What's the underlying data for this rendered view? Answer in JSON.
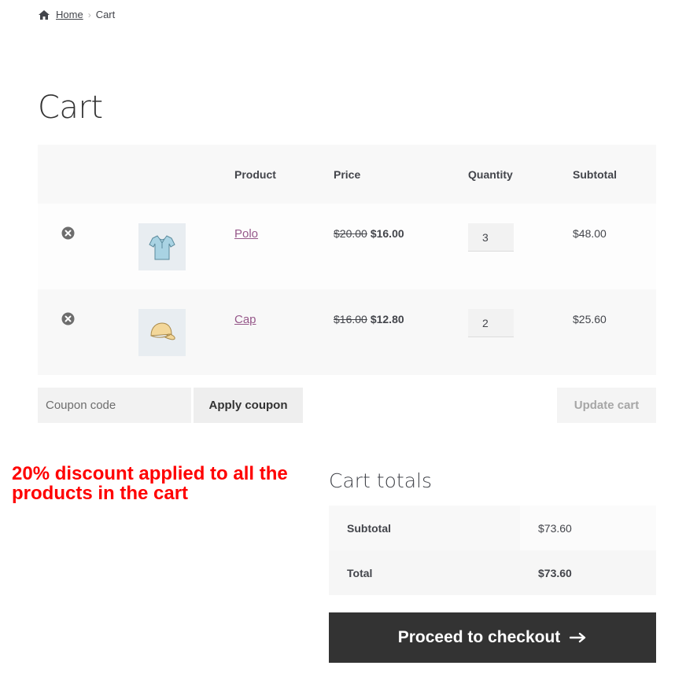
{
  "breadcrumb": {
    "home": "Home",
    "current": "Cart"
  },
  "page": {
    "title": "Cart"
  },
  "table": {
    "headers": {
      "product": "Product",
      "price": "Price",
      "quantity": "Quantity",
      "subtotal": "Subtotal"
    },
    "rows": [
      {
        "name": "Polo",
        "regular_price": "$20.00",
        "sale_price": "$16.00",
        "quantity": "3",
        "subtotal": "$48.00",
        "thumb_icon": "polo-shirt-icon"
      },
      {
        "name": "Cap",
        "regular_price": "$16.00",
        "sale_price": "$12.80",
        "quantity": "2",
        "subtotal": "$25.60",
        "thumb_icon": "cap-icon"
      }
    ]
  },
  "coupon": {
    "placeholder": "Coupon code",
    "apply_label": "Apply coupon"
  },
  "update_label": "Update cart",
  "annotation": "20% discount applied to all the products in the cart",
  "totals": {
    "heading": "Cart totals",
    "subtotal_label": "Subtotal",
    "subtotal_value": "$73.60",
    "total_label": "Total",
    "total_value": "$73.60"
  },
  "checkout_label": "Proceed to checkout",
  "colors": {
    "link": "#96588a",
    "annotation": "#ff0000",
    "checkout_bg": "#333333"
  }
}
